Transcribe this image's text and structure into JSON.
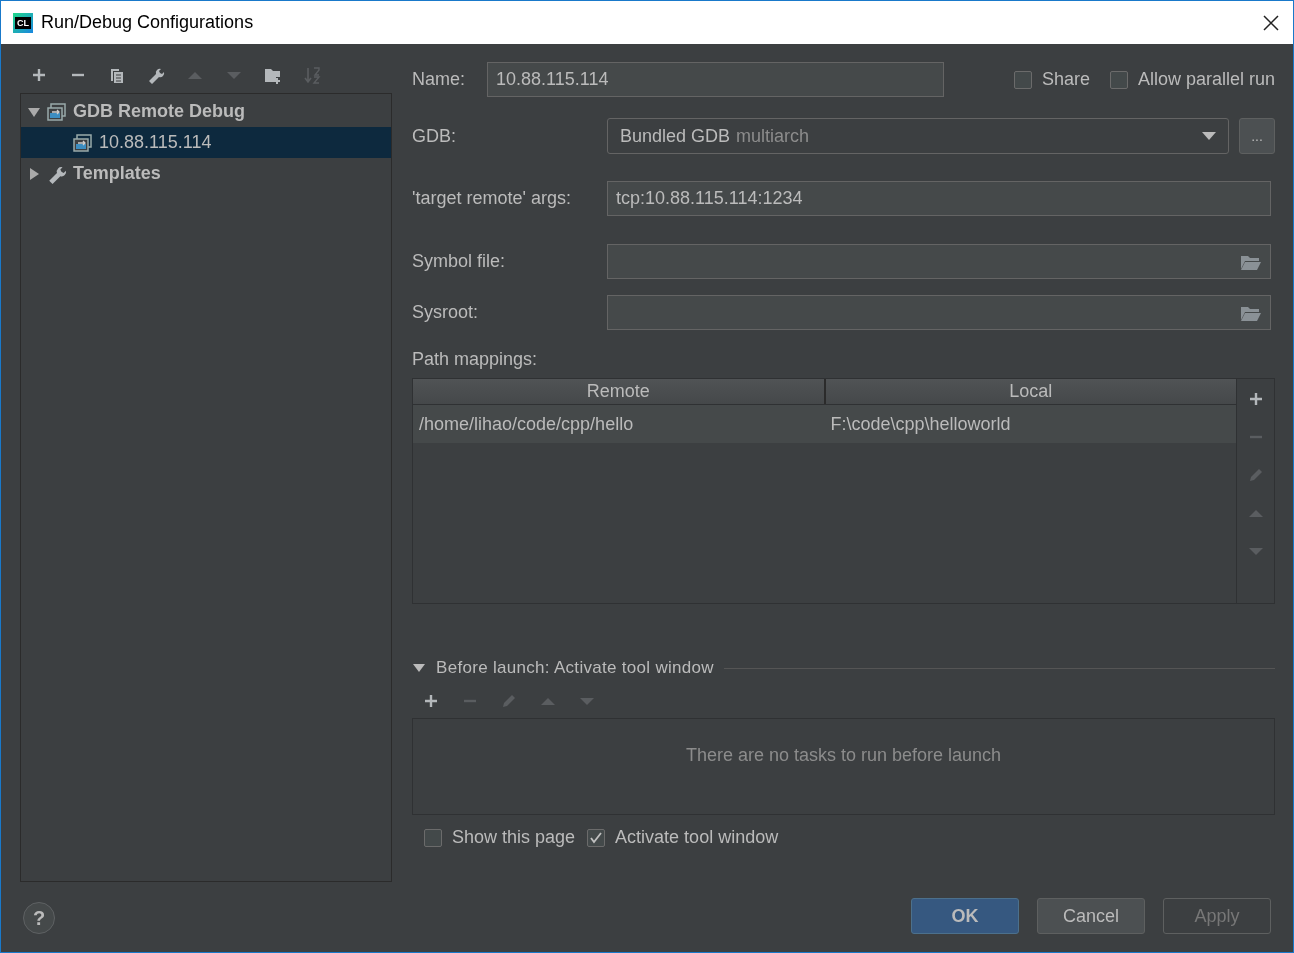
{
  "window": {
    "title": "Run/Debug Configurations",
    "logo": "CL"
  },
  "toolbar": [
    {
      "kind": "add",
      "disabled": false
    },
    {
      "kind": "remove",
      "disabled": false
    },
    {
      "kind": "copy",
      "disabled": false
    },
    {
      "kind": "wrench",
      "disabled": false
    },
    {
      "kind": "up",
      "disabled": true
    },
    {
      "kind": "down",
      "disabled": true
    },
    {
      "kind": "folder",
      "disabled": false
    },
    {
      "kind": "sort",
      "disabled": true
    }
  ],
  "tree": [
    {
      "label": "GDB Remote Debug",
      "kind": "config",
      "expanded": true,
      "selected": false,
      "children": [
        {
          "label": "10.88.115.114",
          "kind": "config",
          "selected": true
        }
      ]
    },
    {
      "label": "Templates",
      "kind": "templates",
      "expanded": false,
      "selected": false
    }
  ],
  "form": {
    "name_label": "Name:",
    "name_value": "10.88.115.114",
    "options": [
      {
        "label": "Share",
        "checked": false
      },
      {
        "label": "Allow parallel run",
        "checked": false
      }
    ],
    "gdb_label": "GDB:",
    "gdb_value": "Bundled GDB",
    "gdb_hint": "multiarch",
    "gdb_more": "...",
    "args_label": "'target remote' args:",
    "args_value": "tcp:10.88.115.114:1234",
    "symbol_label": "Symbol file:",
    "sysroot_label": "Sysroot:"
  },
  "path_mappings": {
    "label": "Path mappings:",
    "columns": [
      "Remote",
      "Local"
    ],
    "rows": [
      {
        "cells": [
          "/home/lihao/code/cpp/hello",
          "F:\\code\\cpp\\helloworld"
        ]
      }
    ],
    "tools": [
      {
        "kind": "add",
        "disabled": false
      },
      {
        "kind": "remove",
        "disabled": true
      },
      {
        "kind": "edit",
        "disabled": true
      },
      {
        "kind": "up",
        "disabled": true
      },
      {
        "kind": "down",
        "disabled": true
      }
    ]
  },
  "before_launch": {
    "title": "Before launch: Activate tool window",
    "expanded": true,
    "tools": [
      {
        "kind": "add",
        "disabled": false
      },
      {
        "kind": "remove",
        "disabled": true
      },
      {
        "kind": "edit",
        "disabled": true
      },
      {
        "kind": "up",
        "disabled": true
      },
      {
        "kind": "down",
        "disabled": true
      }
    ],
    "empty_text": "There are no tasks to run before launch",
    "options": [
      {
        "label": "Show this page",
        "checked": false
      },
      {
        "label": "Activate tool window",
        "checked": true
      }
    ]
  },
  "help": "?",
  "buttons": [
    {
      "label": "OK",
      "kind": "default",
      "disabled": false
    },
    {
      "label": "Cancel",
      "kind": "normal",
      "disabled": false
    },
    {
      "label": "Apply",
      "kind": "normal",
      "disabled": true
    }
  ]
}
